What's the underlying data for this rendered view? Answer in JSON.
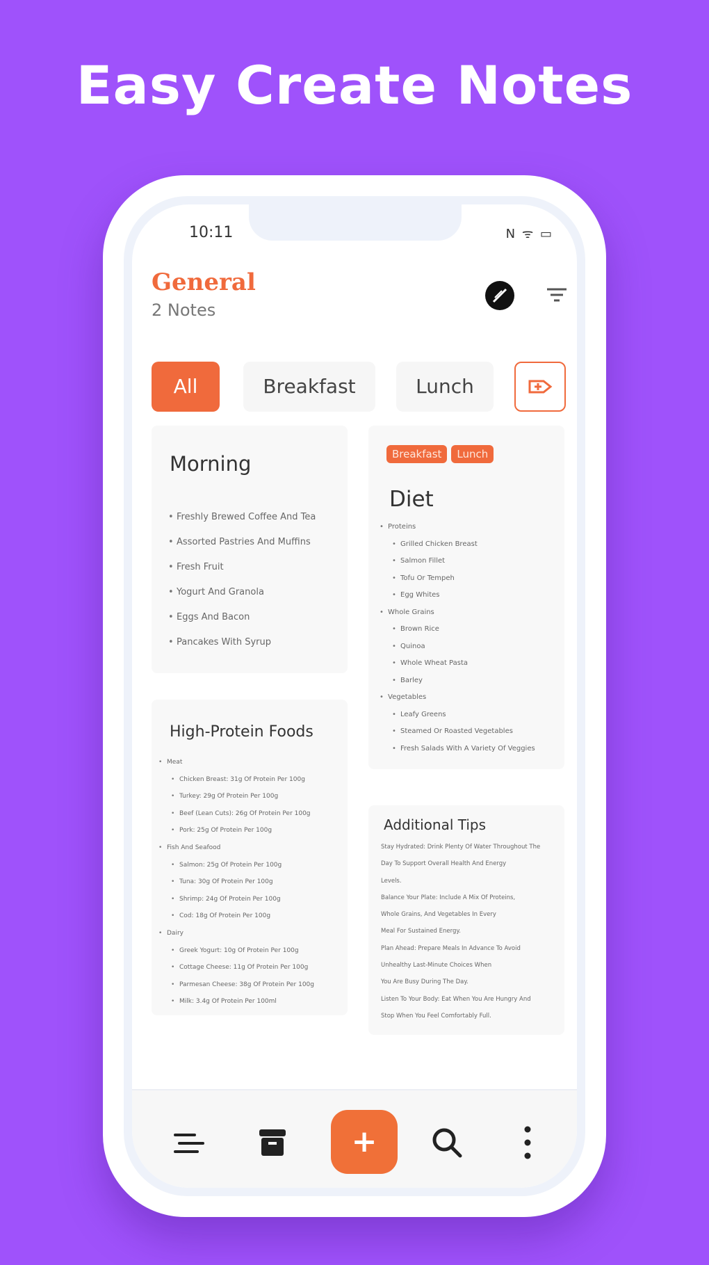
{
  "headline": "Easy Create Notes",
  "status_bar": {
    "time": "10:11",
    "icons": "N ᯤ ▭"
  },
  "header": {
    "title": "General",
    "count": "2 Notes"
  },
  "chips": [
    {
      "label": "All",
      "active": true
    },
    {
      "label": "Breakfast",
      "active": false
    },
    {
      "label": "Lunch",
      "active": false
    }
  ],
  "notes": {
    "morning": {
      "title": "Morning",
      "items": [
        "Freshly Brewed Coffee And Tea",
        "Assorted Pastries And Muffins",
        "Fresh Fruit",
        "Yogurt And Granola",
        "Eggs And Bacon",
        "Pancakes With Syrup"
      ]
    },
    "diet": {
      "tags": [
        "Breakfast",
        "Lunch"
      ],
      "title": "Diet",
      "items": [
        {
          "text": "Proteins",
          "level": 0
        },
        {
          "text": "Grilled Chicken Breast",
          "level": 1
        },
        {
          "text": "Salmon Fillet",
          "level": 1
        },
        {
          "text": "Tofu Or Tempeh",
          "level": 1
        },
        {
          "text": "Egg Whites",
          "level": 1
        },
        {
          "text": "Whole Grains",
          "level": 0
        },
        {
          "text": "Brown Rice",
          "level": 1
        },
        {
          "text": "Quinoa",
          "level": 1
        },
        {
          "text": "Whole Wheat Pasta",
          "level": 1
        },
        {
          "text": "Barley",
          "level": 1
        },
        {
          "text": "Vegetables",
          "level": 0
        },
        {
          "text": "Leafy Greens",
          "level": 1
        },
        {
          "text": "Steamed Or Roasted Vegetables",
          "level": 1
        },
        {
          "text": "Fresh Salads With A Variety Of Veggies",
          "level": 1
        }
      ]
    },
    "protein": {
      "title": "High-Protein Foods",
      "items": [
        {
          "text": "Meat",
          "level": 0
        },
        {
          "text": "Chicken Breast: 31g Of Protein Per 100g",
          "level": 1
        },
        {
          "text": "Turkey: 29g Of Protein Per 100g",
          "level": 1
        },
        {
          "text": "Beef (Lean Cuts): 26g Of Protein Per 100g",
          "level": 1
        },
        {
          "text": "Pork: 25g Of Protein Per 100g",
          "level": 1
        },
        {
          "text": "Fish And Seafood",
          "level": 0
        },
        {
          "text": "Salmon: 25g Of Protein Per 100g",
          "level": 1
        },
        {
          "text": "Tuna: 30g Of Protein Per 100g",
          "level": 1
        },
        {
          "text": "Shrimp: 24g Of Protein Per 100g",
          "level": 1
        },
        {
          "text": "Cod: 18g Of Protein Per 100g",
          "level": 1
        },
        {
          "text": "Dairy",
          "level": 0
        },
        {
          "text": "Greek Yogurt: 10g Of Protein Per 100g",
          "level": 1
        },
        {
          "text": "Cottage Cheese: 11g Of Protein Per 100g",
          "level": 1
        },
        {
          "text": "Parmesan Cheese: 38g Of Protein Per 100g",
          "level": 1
        },
        {
          "text": "Milk: 3.4g Of Protein Per 100ml",
          "level": 1
        }
      ]
    },
    "tips": {
      "title": "Additional Tips",
      "lines": [
        "Stay Hydrated: Drink Plenty Of Water Throughout The",
        "Day To Support Overall Health And Energy",
        "Levels.",
        "Balance Your Plate: Include A Mix Of Proteins,",
        "Whole Grains, And Vegetables In Every",
        "Meal For Sustained Energy.",
        "Plan Ahead: Prepare Meals In Advance To Avoid",
        "Unhealthy Last-Minute Choices When",
        "You Are Busy During The Day.",
        "Listen To Your Body: Eat When You Are Hungry And",
        "Stop When You Feel Comfortably Full."
      ]
    }
  },
  "bottom_nav": {
    "add_label": "+"
  },
  "colors": {
    "background": "#9f52fb",
    "accent": "#f06a3c",
    "card": "#f8f8f8"
  },
  "icons": [
    "theme-icon",
    "filter-icon",
    "add-category-icon",
    "menu-icon",
    "archive-icon",
    "search-icon",
    "more-vert-icon"
  ]
}
